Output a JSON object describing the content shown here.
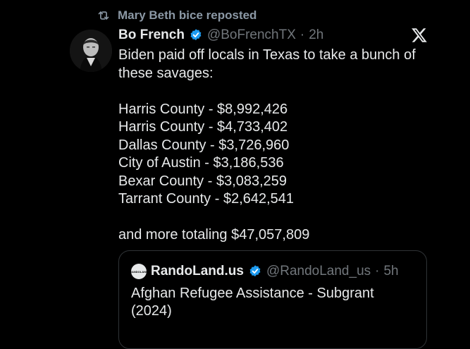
{
  "repost": {
    "icon": "repost-icon",
    "label": "Mary Beth bice reposted"
  },
  "tweet": {
    "author_name": "Bo French",
    "author_handle": "@BoFrenchTX",
    "separator": "·",
    "time": "2h",
    "verified_icon": "verified-badge-icon",
    "platform_icon": "x-logo-icon",
    "lines": {
      "intro": "Biden paid off locals in Texas to take a bunch of these savages:",
      "items": [
        "Harris County - $8,992,426",
        "Harris County - $4,733,402",
        "Dallas County - $3,726,960",
        "City of Austin - $3,186,536",
        "Bexar County - $3,083,259",
        "Tarrant County - $2,642,541"
      ],
      "closing": "and more totaling $47,057,809"
    }
  },
  "quote": {
    "avatar_text": "RANDOLAND",
    "author_name": "RandoLand.us",
    "author_handle": "@RandoLand_us",
    "separator": "·",
    "time": "5h",
    "text": "Afghan Refugee Assistance - Subgrant (2024)"
  },
  "colors": {
    "background": "#000000",
    "text": "#e7e9ea",
    "muted": "#71767b",
    "verified": "#1d9bf0",
    "border": "#2f3336"
  }
}
